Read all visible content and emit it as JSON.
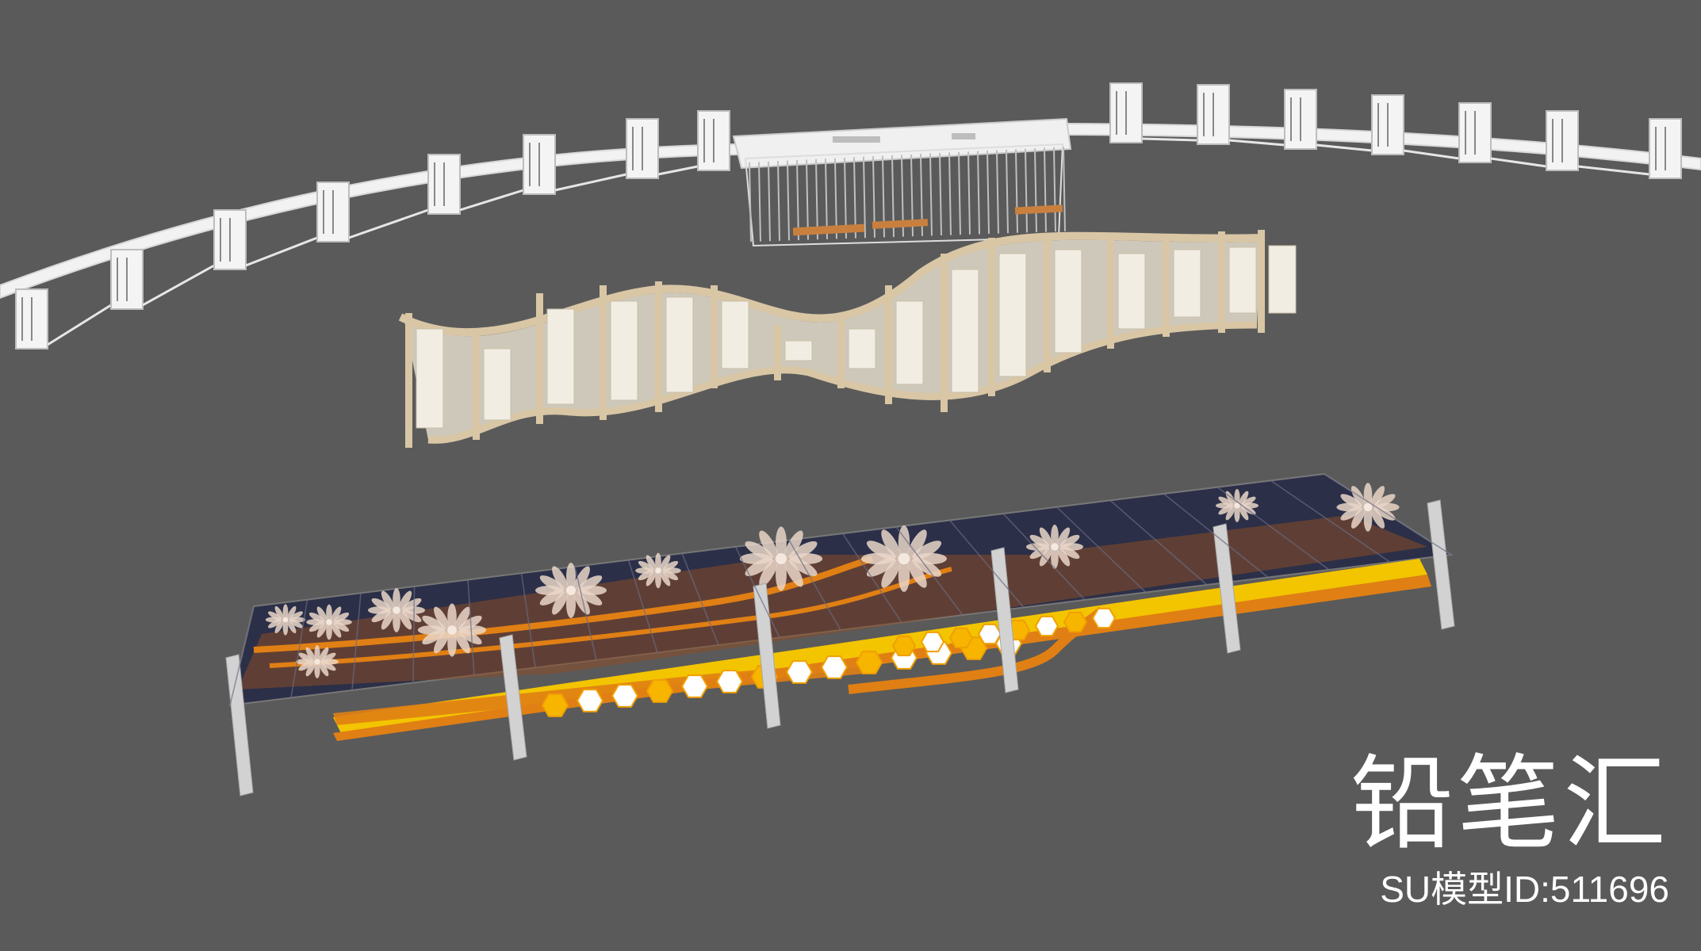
{
  "brand": {
    "title": "铅笔汇",
    "model_id": "SU模型ID:511696"
  },
  "colors": {
    "background": "#5a5a5a",
    "canopy_white": "#f2f2f2",
    "frame_wood": "#d9c6a5",
    "panel_cream": "#ece7da",
    "roof_navy": "#2c2f48",
    "stripe_orange": "#e07f14",
    "stripe_yellow": "#f3c400",
    "post_grey": "#cfcfcf"
  },
  "scene": {
    "objects": [
      {
        "name": "curved-white-canopy-corridor"
      },
      {
        "name": "wavy-wooden-calligraphy-screen"
      },
      {
        "name": "navy-orange-bus-shelter-canopy"
      }
    ]
  }
}
